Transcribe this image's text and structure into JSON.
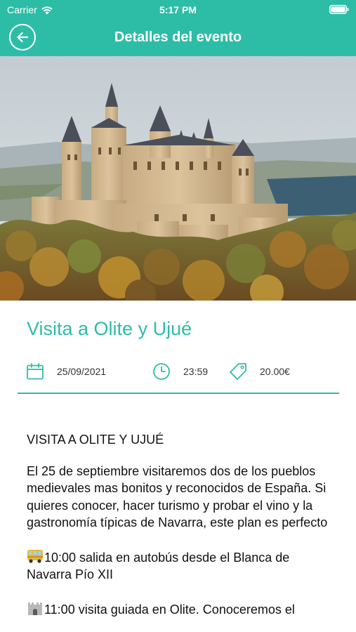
{
  "status_bar": {
    "carrier": "Carrier",
    "time": "5:17 PM"
  },
  "nav": {
    "title": "Detalles del evento",
    "back_icon": "back-arrow-icon"
  },
  "event": {
    "title": "Visita a Olite y Ujué",
    "date": "25/09/2021",
    "time": "23:59",
    "price": "20.00€"
  },
  "description": {
    "heading": "VISITA A OLITE Y UJUÉ",
    "intro": "El 25 de septiembre visitaremos dos de los pueblos medievales mas bonitos y reconocidos de España. Si quieres conocer, hacer turismo y probar el vino y la gastronomía típicas de Navarra, este plan es perfecto",
    "item1": "10:00 salida en autobús desde el Blanca de Navarra Pío XII",
    "item2": "11:00 visita guiada en Olite. Conoceremos el"
  },
  "colors": {
    "accent": "#2dbda6",
    "text": "#111111"
  }
}
